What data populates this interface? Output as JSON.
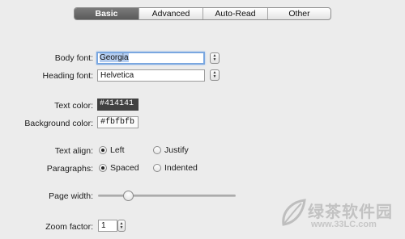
{
  "tabs": [
    "Basic",
    "Advanced",
    "Auto-Read",
    "Other"
  ],
  "active_tab": "Basic",
  "fonts": {
    "body_label": "Body font:",
    "body_value": "Georgia",
    "heading_label": "Heading font:",
    "heading_value": "Helvetica"
  },
  "colors": {
    "text_label": "Text color:",
    "text_value": "#414141",
    "background_label": "Background color:",
    "background_value": "#fbfbfb"
  },
  "text_align": {
    "label": "Text align:",
    "options": [
      "Left",
      "Justify"
    ],
    "selected": "Left"
  },
  "paragraphs": {
    "label": "Paragraphs:",
    "options": [
      "Spaced",
      "Indented"
    ],
    "selected": "Spaced"
  },
  "page_width": {
    "label": "Page width:",
    "value_fraction": 0.2
  },
  "zoom": {
    "label": "Zoom factor:",
    "value": "1"
  },
  "watermark": {
    "name": "绿茶软件园",
    "url": "www.33LC.com"
  }
}
